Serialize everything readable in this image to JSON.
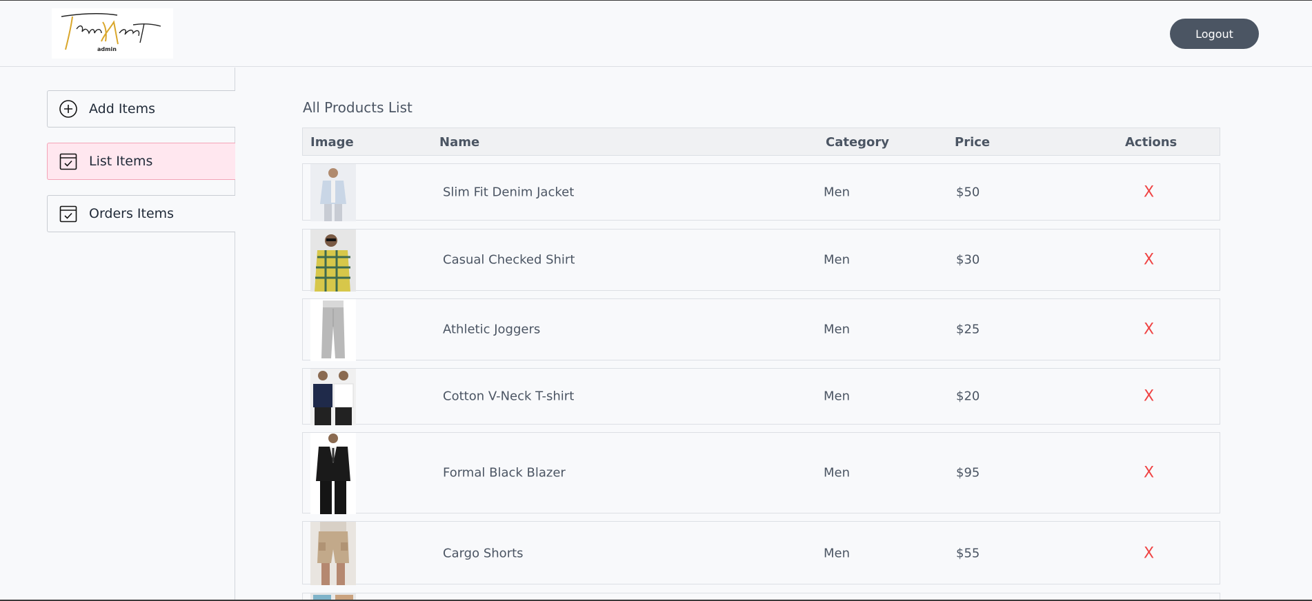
{
  "header": {
    "logo_text": "TrendNest",
    "logo_subtext": "admin",
    "logout_label": "Logout"
  },
  "sidebar": {
    "items": [
      {
        "label": "Add Items",
        "icon": "add-circle-icon",
        "active": false
      },
      {
        "label": "List Items",
        "icon": "calendar-check-icon",
        "active": true
      },
      {
        "label": "Orders Items",
        "icon": "calendar-check-icon",
        "active": false
      }
    ]
  },
  "main": {
    "title": "All Products List",
    "columns": [
      "Image",
      "Name",
      "Category",
      "Price",
      "Actions"
    ],
    "rows": [
      {
        "name": "Slim Fit Denim Jacket",
        "category": "Men",
        "price": "$50",
        "action": "X",
        "thumb": "person-light-jacket"
      },
      {
        "name": "Casual Checked Shirt",
        "category": "Men",
        "price": "$30",
        "action": "X",
        "thumb": "person-checked-shirt"
      },
      {
        "name": "Athletic Joggers",
        "category": "Men",
        "price": "$25",
        "action": "X",
        "thumb": "grey-joggers"
      },
      {
        "name": "Cotton V-Neck T-shirt",
        "category": "Men",
        "price": "$20",
        "action": "X",
        "thumb": "two-men-tshirts"
      },
      {
        "name": "Formal Black Blazer",
        "category": "Men",
        "price": "$95",
        "action": "X",
        "thumb": "black-blazer"
      },
      {
        "name": "Cargo Shorts",
        "category": "Men",
        "price": "$55",
        "action": "X",
        "thumb": "cargo-shorts"
      }
    ]
  },
  "colors": {
    "accent": "#4b5563",
    "active_bg": "#ffe7ef",
    "active_border": "#f3a3b7",
    "delete": "#ef4444"
  }
}
